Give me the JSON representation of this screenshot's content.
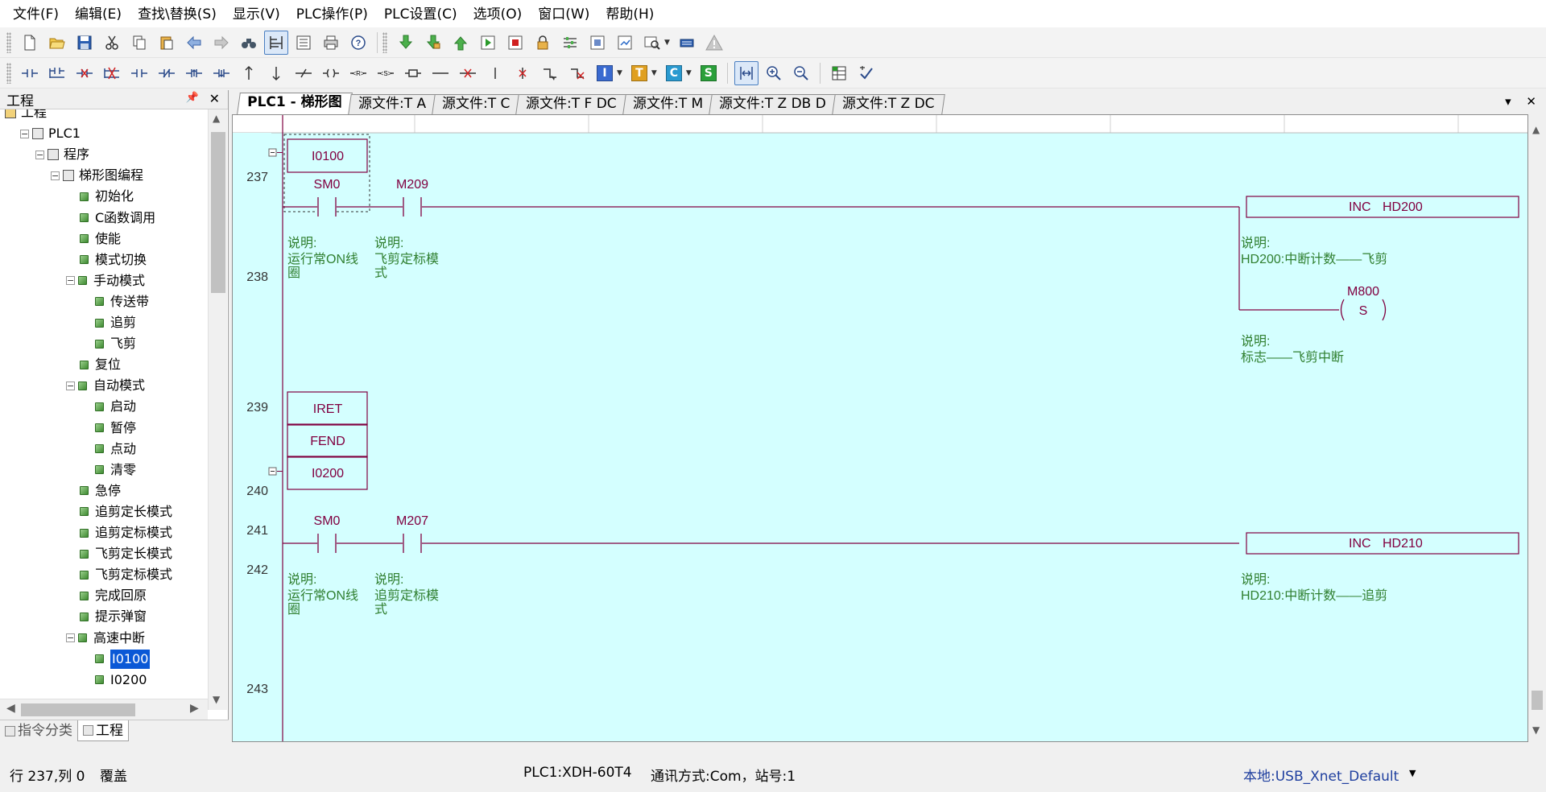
{
  "menu": [
    {
      "label": "文件(F)",
      "name": "menu-file"
    },
    {
      "label": "编辑(E)",
      "name": "menu-edit"
    },
    {
      "label": "查找\\替换(S)",
      "name": "menu-find-replace"
    },
    {
      "label": "显示(V)",
      "name": "menu-view"
    },
    {
      "label": "PLC操作(P)",
      "name": "menu-plc-operation"
    },
    {
      "label": "PLC设置(C)",
      "name": "menu-plc-settings"
    },
    {
      "label": "选项(O)",
      "name": "menu-options"
    },
    {
      "label": "窗口(W)",
      "name": "menu-window"
    },
    {
      "label": "帮助(H)",
      "name": "menu-help"
    }
  ],
  "toolbar2_letters": {
    "instr": "I",
    "text": "T",
    "comment": "C",
    "step": "S"
  },
  "left_panel": {
    "title": "工程",
    "tree": [
      {
        "label": "工程",
        "level": 0,
        "kind": "root"
      },
      {
        "label": "PLC1",
        "level": 1,
        "kind": "folder"
      },
      {
        "label": "程序",
        "level": 2,
        "kind": "folder"
      },
      {
        "label": "梯形图编程",
        "level": 3,
        "kind": "folder"
      },
      {
        "label": "初始化",
        "level": 4,
        "kind": "leaf"
      },
      {
        "label": "C函数调用",
        "level": 4,
        "kind": "leaf"
      },
      {
        "label": "使能",
        "level": 4,
        "kind": "leaf"
      },
      {
        "label": "模式切换",
        "level": 4,
        "kind": "leaf"
      },
      {
        "label": "手动模式",
        "level": 4,
        "kind": "group"
      },
      {
        "label": "传送带",
        "level": 5,
        "kind": "leaf"
      },
      {
        "label": "追剪",
        "level": 5,
        "kind": "leaf"
      },
      {
        "label": "飞剪",
        "level": 5,
        "kind": "leaf"
      },
      {
        "label": "复位",
        "level": 4,
        "kind": "leaf"
      },
      {
        "label": "自动模式",
        "level": 4,
        "kind": "group"
      },
      {
        "label": "启动",
        "level": 5,
        "kind": "leaf"
      },
      {
        "label": "暂停",
        "level": 5,
        "kind": "leaf"
      },
      {
        "label": "点动",
        "level": 5,
        "kind": "leaf"
      },
      {
        "label": "清零",
        "level": 5,
        "kind": "leaf"
      },
      {
        "label": "急停",
        "level": 4,
        "kind": "leaf"
      },
      {
        "label": "追剪定长模式",
        "level": 4,
        "kind": "leaf"
      },
      {
        "label": "追剪定标模式",
        "level": 4,
        "kind": "leaf"
      },
      {
        "label": "飞剪定长模式",
        "level": 4,
        "kind": "leaf"
      },
      {
        "label": "飞剪定标模式",
        "level": 4,
        "kind": "leaf"
      },
      {
        "label": "完成回原",
        "level": 4,
        "kind": "leaf"
      },
      {
        "label": "提示弹窗",
        "level": 4,
        "kind": "leaf"
      },
      {
        "label": "高速中断",
        "level": 4,
        "kind": "group"
      },
      {
        "label": "I0100",
        "level": 5,
        "kind": "leaf",
        "selected": true
      },
      {
        "label": "I0200",
        "level": 5,
        "kind": "leaf"
      }
    ],
    "tabs": [
      {
        "label": "指令分类",
        "active": false
      },
      {
        "label": "工程",
        "active": true
      }
    ]
  },
  "doc_tabs": [
    {
      "label": "PLC1 - 梯形图",
      "active": true
    },
    {
      "label": "源文件:T A",
      "active": false
    },
    {
      "label": "源文件:T C",
      "active": false
    },
    {
      "label": "源文件:T F DC",
      "active": false
    },
    {
      "label": "源文件:T M",
      "active": false
    },
    {
      "label": "源文件:T Z DB D",
      "active": false
    },
    {
      "label": "源文件:T Z DC",
      "active": false
    }
  ],
  "ladder": {
    "colors": {
      "bg": "#d4ffff",
      "wire": "#800040",
      "text": "#800040",
      "comment": "#2f7f2f",
      "header": "#ffffff"
    },
    "comment_prefix": "说明:",
    "rows": [
      {
        "num": "237",
        "items": [
          {
            "type": "label_box",
            "text": "I0100"
          }
        ]
      },
      {
        "num": "238",
        "contacts": [
          {
            "name": "SM0",
            "comment": [
              "运行常ON线",
              "圈"
            ]
          },
          {
            "name": "M209",
            "comment": [
              "飞剪定标模",
              "式"
            ]
          }
        ],
        "output": {
          "type": "box",
          "op": "INC",
          "arg": "HD200",
          "comment": [
            "HD200:中断计数——飞剪"
          ]
        }
      },
      {
        "num": "239",
        "output": {
          "type": "coil",
          "name": "M800",
          "kind": "S",
          "comment": [
            "标志——飞剪中断"
          ]
        }
      },
      {
        "num": "240",
        "items": [
          {
            "type": "label_box",
            "text": "IRET"
          }
        ]
      },
      {
        "num": "241",
        "items": [
          {
            "type": "label_box",
            "text": "FEND"
          }
        ]
      },
      {
        "num": "242",
        "items": [
          {
            "type": "label_box",
            "text": "I0200"
          }
        ]
      },
      {
        "num": "243",
        "contacts": [
          {
            "name": "SM0",
            "comment": [
              "运行常ON线",
              "圈"
            ]
          },
          {
            "name": "M207",
            "comment": [
              "追剪定标模",
              "式"
            ]
          }
        ],
        "output": {
          "type": "box",
          "op": "INC",
          "arg": "HD210",
          "comment": [
            "HD210:中断计数——追剪"
          ]
        }
      }
    ]
  },
  "status": {
    "position": "行 237,列 0",
    "mode": "覆盖",
    "plc": "PLC1:XDH-60T4",
    "comm": "通讯方式:Com，站号:1",
    "local": "本地:USB_Xnet_Default"
  }
}
